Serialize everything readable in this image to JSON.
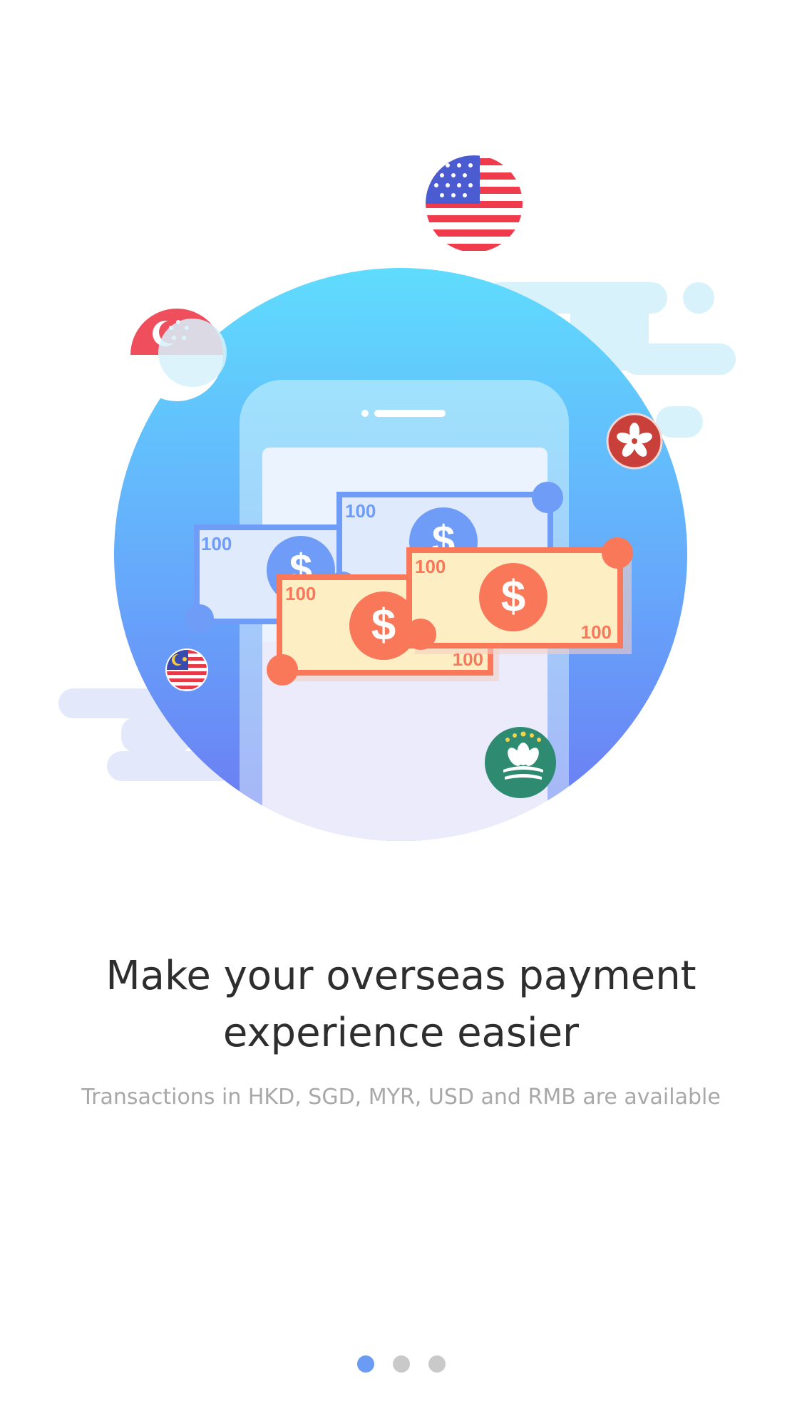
{
  "onboarding": {
    "headline_line1": "Make your overseas payment",
    "headline_line2": "experience easier",
    "subtitle": "Transactions in HKD, SGD, MYR, USD and RMB are available",
    "page_indicator": {
      "total_pages": 3,
      "current_page": 1
    }
  },
  "illustration": {
    "bills": {
      "denomination": "100",
      "symbol": "$"
    },
    "flags": [
      "usa-flag-icon",
      "singapore-flag-icon",
      "hong-kong-flag-icon",
      "malaysia-flag-icon",
      "macau-flag-icon"
    ],
    "colors": {
      "circle_top": "#5fdcfd",
      "circle_bottom": "#6a7ff4",
      "bill_blue": "#6e9cf6",
      "bill_orange": "#f9785a",
      "bill_cream": "#fdeec4",
      "dot_active": "#6b9cf5",
      "dot_inactive": "#c9c9c9"
    }
  }
}
